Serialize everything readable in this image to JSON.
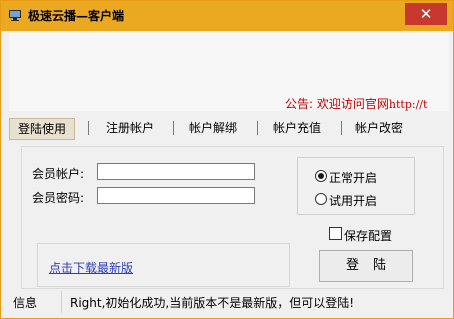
{
  "window": {
    "title": "极速云播—客户端",
    "close_symbol": "✕"
  },
  "notice": {
    "prefix": "公告:",
    "message": "欢迎访问官网",
    "url": "http://t"
  },
  "tabs": [
    {
      "label": "登陆使用",
      "active": true
    },
    {
      "label": "注册帐户",
      "active": false
    },
    {
      "label": "帐户解绑",
      "active": false
    },
    {
      "label": "帐户充值",
      "active": false
    },
    {
      "label": "帐户改密",
      "active": false
    }
  ],
  "login_form": {
    "account_label": "会员帐户:",
    "account_value": "",
    "password_label": "会员密码:",
    "password_value": ""
  },
  "mode": {
    "options": [
      {
        "label": "正常开启",
        "selected": true
      },
      {
        "label": "试用开启",
        "selected": false
      }
    ]
  },
  "save_config": {
    "label": "保存配置",
    "checked": false
  },
  "download_link": "点击下载最新版",
  "login_button": "登陆",
  "status": {
    "label": "信息",
    "message": "Right,初始化成功,当前版本不是最新版，但可以登陆!"
  },
  "colors": {
    "titlebar": "#eba821",
    "close_button": "#c7392f",
    "notice_text": "#c00000",
    "link": "#2e3eb8"
  },
  "icons": {
    "app": "monitor-icon",
    "close": "close-icon"
  }
}
